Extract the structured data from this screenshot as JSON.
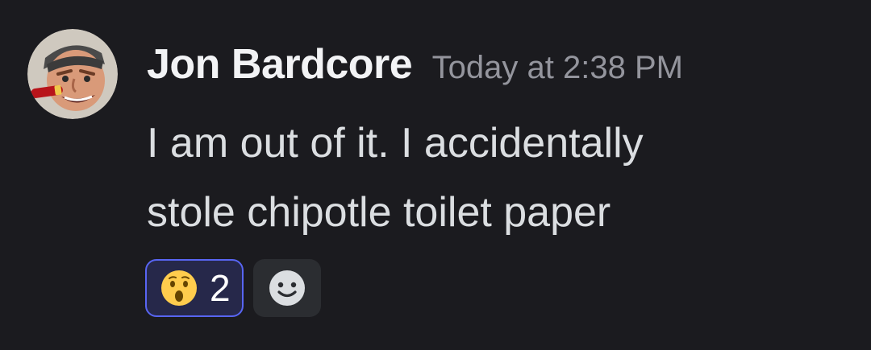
{
  "message": {
    "author": "Jon Bardcore",
    "timestamp": "Today at 2:38 PM",
    "content_lines": [
      "I am out of it. I accidentally",
      "stole chipotle toilet paper"
    ]
  },
  "reactions": [
    {
      "emoji": "astonished-face-icon",
      "count": "2",
      "selected": true
    }
  ],
  "add_reaction": {
    "icon": "smiley-icon"
  },
  "colors": {
    "background": "#1b1b1f",
    "username": "#f2f3f5",
    "timestamp": "#94959d",
    "text": "#dbdee1",
    "reaction_border": "#5865f2",
    "reaction_bg": "#26284a"
  }
}
